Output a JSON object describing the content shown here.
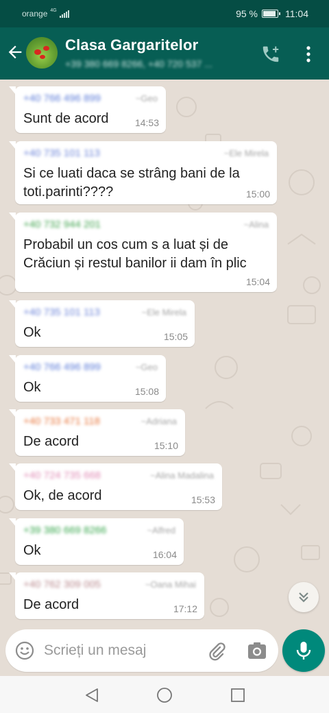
{
  "status_bar": {
    "carrier": "orange",
    "network": "4G",
    "battery": "95 %",
    "battery_level": 0.95,
    "time": "11:04"
  },
  "header": {
    "title": "Clasa Gargaritelor",
    "subtitle": "+39 380 669 8266, +40 720 537 ..."
  },
  "messages": [
    {
      "sender": "+40 766 496 899",
      "alias": "~Geo",
      "sender_color": "#5b7bd8",
      "text": [
        "Sunt de acord"
      ],
      "time": "14:53"
    },
    {
      "sender": "+40 735 101 113",
      "alias": "~Ele Mirela",
      "sender_color": "#6a82d8",
      "text": [
        "Si ce luati daca se strâng bani de la",
        "toti.parinti????"
      ],
      "time": "15:00"
    },
    {
      "sender": "+40 732 944 201",
      "alias": "~Alina",
      "sender_color": "#3fa34d",
      "text": [
        "Probabil un cos cum s a luat și de",
        "Crăciun și restul banilor ii dam în plic"
      ],
      "time": "15:04"
    },
    {
      "sender": "+40 735 101 113",
      "alias": "~Ele Mirela",
      "sender_color": "#6a82d8",
      "text": [
        "Ok"
      ],
      "time": "15:05"
    },
    {
      "sender": "+40 766 496 899",
      "alias": "~Geo",
      "sender_color": "#5b7bd8",
      "text": [
        "Ok"
      ],
      "time": "15:08"
    },
    {
      "sender": "+40 733 471 118",
      "alias": "~Adriana",
      "sender_color": "#e8753a",
      "text": [
        "De acord"
      ],
      "time": "15:10"
    },
    {
      "sender": "+40 724 735 668",
      "alias": "~Alina Madalina",
      "sender_color": "#e08ab4",
      "text": [
        "Ok, de acord"
      ],
      "time": "15:53"
    },
    {
      "sender": "+39 380 669 8266",
      "alias": "~Alfred",
      "sender_color": "#35a64a",
      "text": [
        "Ok"
      ],
      "time": "16:04"
    },
    {
      "sender": "+40 762 309 005",
      "alias": "~Oana Mihai",
      "sender_color": "#b8888c",
      "text": [
        "De acord"
      ],
      "time": "17:12"
    }
  ],
  "input": {
    "placeholder": "Scrieți un mesaj"
  },
  "icons": {
    "back": "arrow-left-icon",
    "call_add": "phone-plus-icon",
    "menu": "more-vertical-icon",
    "scroll": "double-chevron-down-icon",
    "emoji": "emoji-icon",
    "attach": "paperclip-icon",
    "camera": "camera-icon",
    "mic": "microphone-icon"
  },
  "colors": {
    "header": "#075e54",
    "status_bar": "#054d44",
    "chat_bg": "#e5ddd5",
    "accent": "#00897b"
  }
}
